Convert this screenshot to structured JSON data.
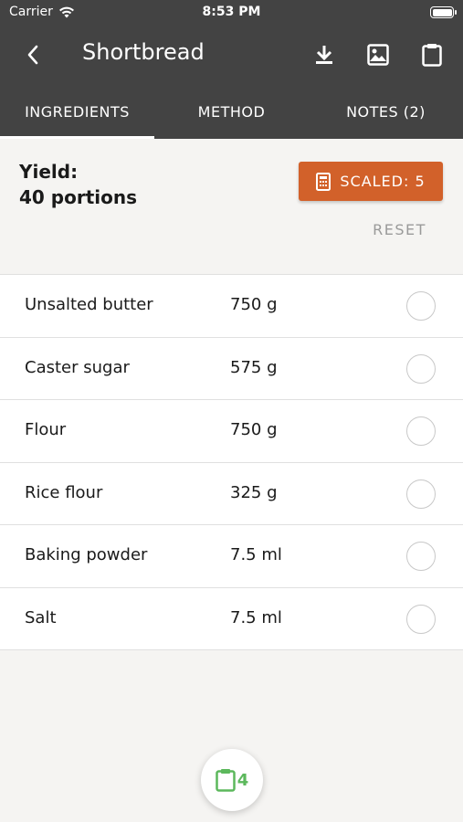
{
  "status_bar": {
    "carrier": "Carrier",
    "time": "8:53 PM"
  },
  "nav": {
    "title": "Shortbread",
    "icons": [
      "back-chevron-icon",
      "download-icon",
      "image-icon",
      "clipboard-icon"
    ]
  },
  "tabs": [
    {
      "label": "INGREDIENTS",
      "active": true
    },
    {
      "label": "METHOD",
      "active": false
    },
    {
      "label": "NOTES (2)",
      "active": false
    }
  ],
  "yield": {
    "label": "Yield:",
    "value": "40 portions",
    "scaled_label": "SCALED: 5",
    "reset_label": "RESET"
  },
  "ingredients": [
    {
      "name": "Unsalted butter",
      "qty": "750 g"
    },
    {
      "name": "Caster sugar",
      "qty": "575 g"
    },
    {
      "name": "Flour",
      "qty": "750 g"
    },
    {
      "name": "Rice flour",
      "qty": "325 g"
    },
    {
      "name": "Baking powder",
      "qty": "7.5 ml"
    },
    {
      "name": "Salt",
      "qty": "7.5 ml"
    }
  ],
  "fab": {
    "count": "4"
  },
  "colors": {
    "header": "#434343",
    "accent": "#d2612a",
    "fab_green": "#5cb85c"
  }
}
